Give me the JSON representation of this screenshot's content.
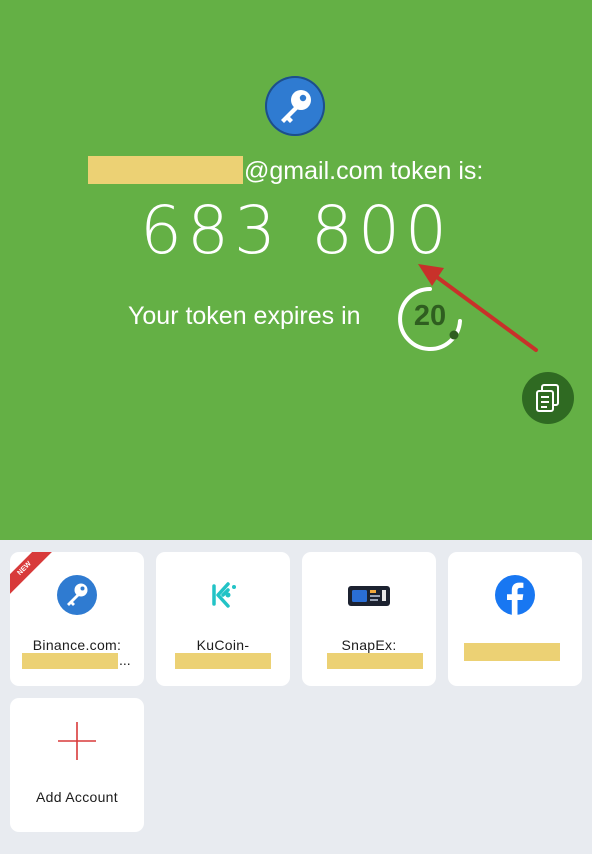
{
  "header": {
    "email_suffix": "@gmail.com token is:",
    "token_part1": "683",
    "token_part2": "800",
    "expires_label": "Your token expires in",
    "seconds_left": "20",
    "icons": {
      "account": "key-icon",
      "copy": "copy-icon"
    },
    "colors": {
      "background": "#64b045",
      "copy_button": "#2f6a22",
      "redaction": "#ecd174"
    }
  },
  "accounts": [
    {
      "label": "Binance.com:",
      "ellipsis": "...",
      "badge": "NEW",
      "icon": "key-icon"
    },
    {
      "label": "KuCoin-",
      "icon": "kucoin-logo-icon"
    },
    {
      "label": "SnapEx:",
      "icon": "snapex-logo-icon"
    },
    {
      "label": "",
      "icon": "facebook-logo-icon"
    }
  ],
  "add_account": {
    "label": "Add Account",
    "icon": "plus-icon"
  }
}
